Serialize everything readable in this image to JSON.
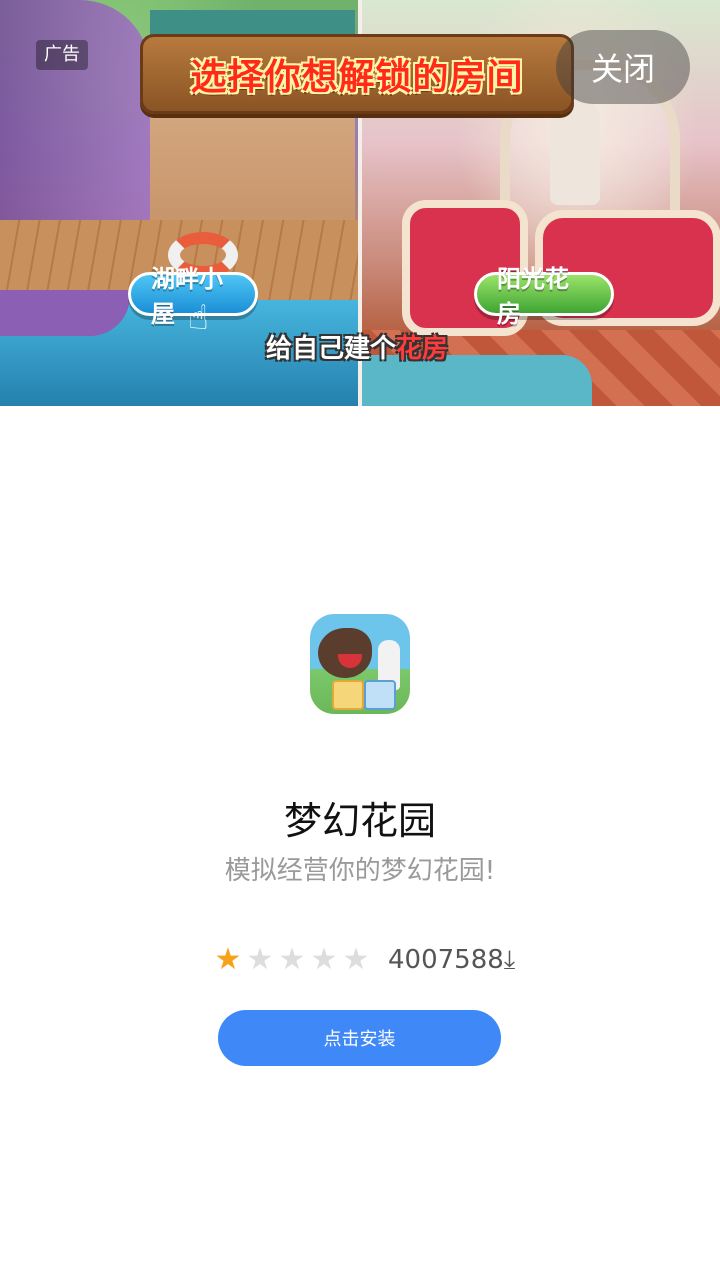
{
  "ad": {
    "tag_label": "广告",
    "close_label": "关闭",
    "banner": {
      "title": "选择你想解锁的房间",
      "left_room_label": "湖畔小屋",
      "right_room_label": "阳光花房",
      "caption_prefix": "给自己建个",
      "caption_highlight": "花房"
    }
  },
  "app": {
    "name": "梦幻花园",
    "description": "模拟经营你的梦幻花园!",
    "rating": {
      "value": 1,
      "max": 5
    },
    "downloads": "4007588",
    "download_icon": "download-icon",
    "install_label": "点击安装"
  },
  "colors": {
    "install_button": "#3f88f7",
    "star_active": "#f7a21b",
    "star_inactive": "#dddddd"
  }
}
